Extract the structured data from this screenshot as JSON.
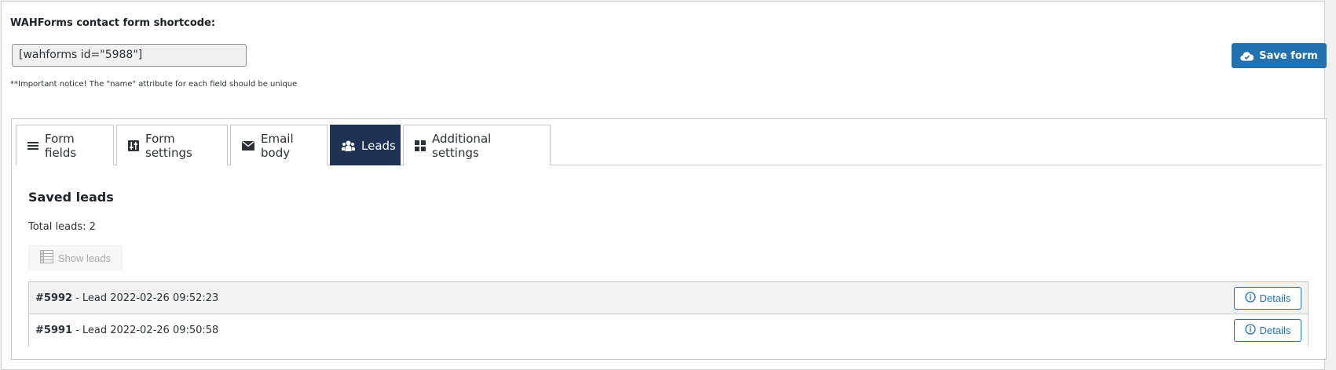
{
  "header": {
    "shortcode_title": "WAHForms contact form shortcode:",
    "shortcode_value": "[wahforms id=\"5988\"]",
    "notice": "**Important notice! The \"name\" attribute for each field should be unique",
    "save_label": "Save form"
  },
  "tabs": [
    {
      "label": "Form fields",
      "icon": "list-icon",
      "active": false
    },
    {
      "label": "Form settings",
      "icon": "settings-icon",
      "active": false
    },
    {
      "label": "Email body",
      "icon": "envelope-icon",
      "active": false
    },
    {
      "label": "Leads",
      "icon": "users-icon",
      "active": true
    },
    {
      "label": "Additional settings",
      "icon": "grid-icon",
      "active": false
    }
  ],
  "leads": {
    "title": "Saved leads",
    "total": "Total leads: 2",
    "show_label": "Show leads",
    "items": [
      {
        "id": "#5992",
        "text": " - Lead 2022-02-26 09:52:23",
        "details_label": "Details"
      },
      {
        "id": "#5991",
        "text": " - Lead 2022-02-26 09:50:58",
        "details_label": "Details"
      }
    ]
  },
  "colors": {
    "accent": "#2271b1",
    "active_tab": "#1e3354"
  }
}
